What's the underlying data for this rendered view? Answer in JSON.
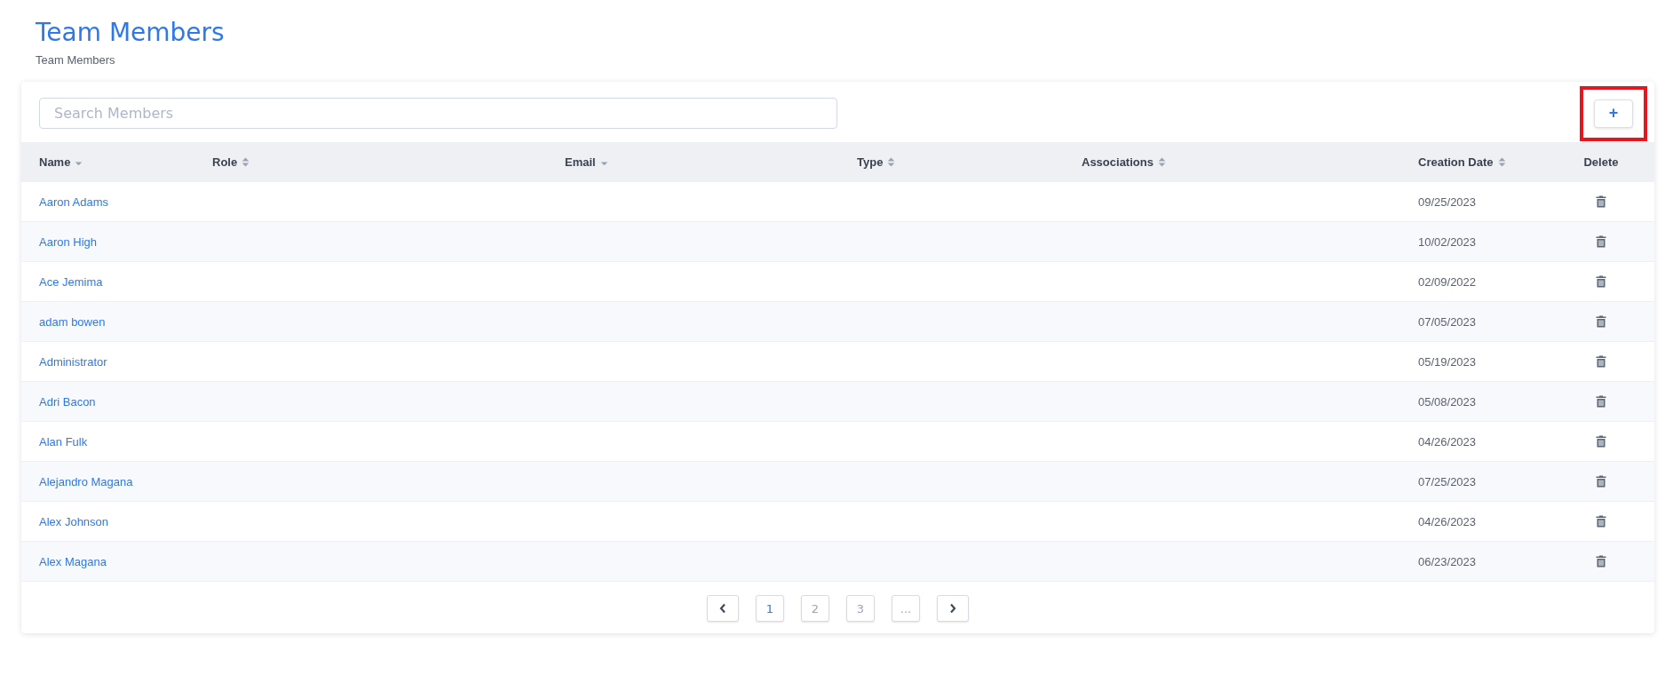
{
  "page": {
    "title": "Team Members",
    "breadcrumb": "Team Members"
  },
  "search": {
    "placeholder": "Search Members"
  },
  "add_button": {
    "label": "+",
    "highlighted": true
  },
  "table": {
    "columns": [
      {
        "label": "Name",
        "sortable": true,
        "sorted": true
      },
      {
        "label": "Role",
        "sortable": true,
        "sorted": false
      },
      {
        "label": "Email",
        "sortable": true,
        "sorted": true
      },
      {
        "label": "Type",
        "sortable": true,
        "sorted": false
      },
      {
        "label": "Associations",
        "sortable": true,
        "sorted": false
      },
      {
        "label": "Creation Date",
        "sortable": true,
        "sorted": false
      },
      {
        "label": "Delete",
        "sortable": false
      }
    ],
    "rows": [
      {
        "name": "Aaron Adams",
        "creation_date": "09/25/2023"
      },
      {
        "name": "Aaron High",
        "creation_date": "10/02/2023"
      },
      {
        "name": "Ace Jemima",
        "creation_date": "02/09/2022"
      },
      {
        "name": "adam bowen",
        "creation_date": "07/05/2023"
      },
      {
        "name": "Administrator",
        "creation_date": "05/19/2023"
      },
      {
        "name": "Adri Bacon",
        "creation_date": "05/08/2023"
      },
      {
        "name": "Alan Fulk",
        "creation_date": "04/26/2023"
      },
      {
        "name": "Alejandro Magana",
        "creation_date": "07/25/2023"
      },
      {
        "name": "Alex Johnson",
        "creation_date": "04/26/2023"
      },
      {
        "name": "Alex Magana",
        "creation_date": "06/23/2023"
      }
    ]
  },
  "pagination": {
    "pages": [
      {
        "label": "1",
        "selected": true
      },
      {
        "label": "2",
        "selected": false
      },
      {
        "label": "3",
        "selected": false
      },
      {
        "label": "...",
        "selected": false
      }
    ]
  }
}
